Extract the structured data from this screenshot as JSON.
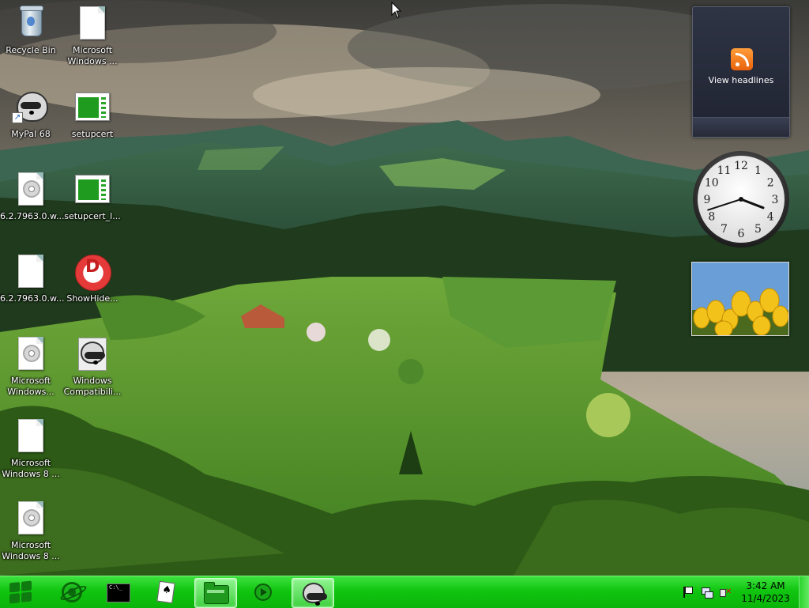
{
  "desktop": {
    "icons": [
      {
        "label": "Recycle Bin"
      },
      {
        "label": "Microsoft\nWindows ..."
      },
      {
        "label": "MyPal 68"
      },
      {
        "label": "setupcert"
      },
      {
        "label": "6.2.7963.0.w..."
      },
      {
        "label": "setupcert_l..."
      },
      {
        "label": "6.2.7963.0.w..."
      },
      {
        "label": "ShowHide..."
      },
      {
        "label": "Microsoft\nWindows..."
      },
      {
        "label": "Windows\nCompatibili..."
      },
      {
        "label": "Microsoft\nWindows 8 ..."
      },
      {
        "label": "Microsoft\nWindows 8 ..."
      }
    ]
  },
  "gadgets": {
    "rss": {
      "label": "View headlines"
    },
    "clock": {
      "numerals": [
        "12",
        "1",
        "2",
        "3",
        "4",
        "5",
        "6",
        "7",
        "8",
        "9",
        "10",
        "11"
      ],
      "hour": 3,
      "minute": 42
    },
    "photo": {
      "subject": "yellow-tulips"
    }
  },
  "taskbar": {
    "buttons": [
      {
        "name": "internet-explorer-icon"
      },
      {
        "name": "command-prompt-icon"
      },
      {
        "name": "solitaire-icon"
      },
      {
        "name": "folder-icon",
        "active": true
      },
      {
        "name": "media-player-icon"
      },
      {
        "name": "mypal-icon",
        "active": true
      }
    ],
    "time": "3:42 AM",
    "date": "11/4/2023"
  },
  "colors": {
    "taskbar": "#10c510",
    "rss_orange": "#f07a1c"
  }
}
